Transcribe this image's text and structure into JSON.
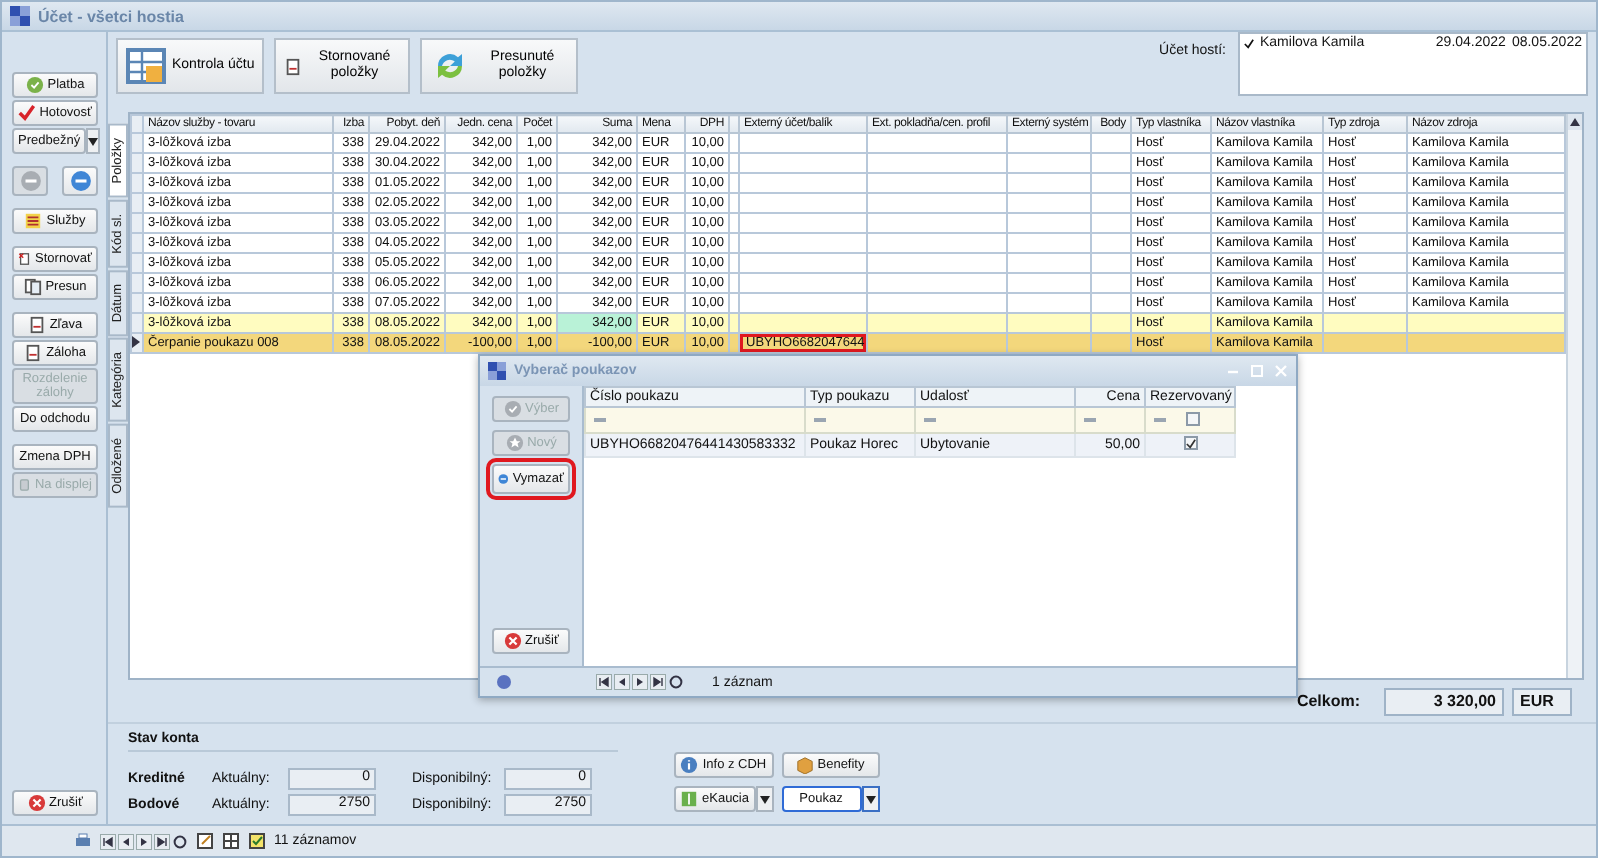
{
  "window": {
    "title": "Účet - všetci hostia"
  },
  "sidebar": {
    "groups": [
      [
        {
          "kind": "button",
          "label": "Platba",
          "disabled": false
        },
        {
          "kind": "button",
          "label": "Hotovosť",
          "disabled": false
        },
        {
          "kind": "dropdown",
          "label": "Predbežný",
          "disabled": false
        }
      ],
      [
        {
          "kind": "icons",
          "buttons": [
            {
              "disabled": true
            },
            {
              "disabled": false
            }
          ]
        }
      ],
      [
        {
          "kind": "button",
          "label": "Služby",
          "disabled": false
        }
      ],
      [
        {
          "kind": "button",
          "label": "Stornovať",
          "disabled": false
        },
        {
          "kind": "button",
          "label": "Presun",
          "disabled": false
        }
      ],
      [
        {
          "kind": "button",
          "label": "Zľava",
          "disabled": false
        },
        {
          "kind": "button",
          "label": "Záloha",
          "disabled": false
        },
        {
          "kind": "button",
          "label": "Rozdelenie zálohy",
          "disabled": true
        },
        {
          "kind": "button",
          "label": "Do odchodu",
          "disabled": false
        }
      ],
      [
        {
          "kind": "button",
          "label": "Zmena DPH",
          "disabled": false
        },
        {
          "kind": "button",
          "label": "Na displej",
          "disabled": true
        }
      ]
    ],
    "cancel": {
      "label": "Zrušiť"
    }
  },
  "toolbar": [
    {
      "label": "Kontrola účtu"
    },
    {
      "label": "Stornované položky"
    },
    {
      "label": "Presunuté položky"
    }
  ],
  "guest_accounts": {
    "label": "Účet hostí:",
    "items": [
      {
        "checked": true,
        "name": "Kamilova Kamila",
        "from": "29.04.2022",
        "to": "08.05.2022"
      }
    ]
  },
  "tabs": [
    {
      "label": "Položky",
      "selected": true
    },
    {
      "label": "Kód sl.",
      "selected": false
    },
    {
      "label": "Dátum",
      "selected": false
    },
    {
      "label": "Kategória",
      "selected": false
    },
    {
      "label": "Odložené",
      "selected": false
    }
  ],
  "table": {
    "columns": [
      {
        "label": "Názov služby - tovaru"
      },
      {
        "label": "Izba"
      },
      {
        "label": "Pobyt. deň"
      },
      {
        "label": "Jedn. cena"
      },
      {
        "label": "Počet"
      },
      {
        "label": "Suma"
      },
      {
        "label": "Mena"
      },
      {
        "label": "DPH"
      },
      {},
      {
        "label": "Externý účet/balík"
      },
      {
        "label": "Ext. pokladňa/cen. profil"
      },
      {
        "label": "Externý systém"
      },
      {
        "label": "Body"
      },
      {
        "label": "Typ vlastníka"
      },
      {
        "label": "Názov vlastníka"
      },
      {
        "label": "Typ zdroja"
      },
      {
        "label": "Názov zdroja"
      }
    ],
    "rows": [
      {
        "selected": false,
        "marked": false,
        "cells": [
          "3-lôžková izba",
          "338",
          "29.04.2022",
          "342,00",
          "1,00",
          "342,00",
          "EUR",
          "10,00",
          null,
          null,
          null,
          null,
          null,
          "Hosť",
          "Kamilova Kamila",
          "Hosť",
          "Kamilova Kamila"
        ]
      },
      {
        "selected": false,
        "marked": false,
        "cells": [
          "3-lôžková izba",
          "338",
          "30.04.2022",
          "342,00",
          "1,00",
          "342,00",
          "EUR",
          "10,00",
          null,
          null,
          null,
          null,
          null,
          "Hosť",
          "Kamilova Kamila",
          "Hosť",
          "Kamilova Kamila"
        ]
      },
      {
        "selected": false,
        "marked": false,
        "cells": [
          "3-lôžková izba",
          "338",
          "01.05.2022",
          "342,00",
          "1,00",
          "342,00",
          "EUR",
          "10,00",
          null,
          null,
          null,
          null,
          null,
          "Hosť",
          "Kamilova Kamila",
          "Hosť",
          "Kamilova Kamila"
        ]
      },
      {
        "selected": false,
        "marked": false,
        "cells": [
          "3-lôžková izba",
          "338",
          "02.05.2022",
          "342,00",
          "1,00",
          "342,00",
          "EUR",
          "10,00",
          null,
          null,
          null,
          null,
          null,
          "Hosť",
          "Kamilova Kamila",
          "Hosť",
          "Kamilova Kamila"
        ]
      },
      {
        "selected": false,
        "marked": false,
        "cells": [
          "3-lôžková izba",
          "338",
          "03.05.2022",
          "342,00",
          "1,00",
          "342,00",
          "EUR",
          "10,00",
          null,
          null,
          null,
          null,
          null,
          "Hosť",
          "Kamilova Kamila",
          "Hosť",
          "Kamilova Kamila"
        ]
      },
      {
        "selected": false,
        "marked": false,
        "cells": [
          "3-lôžková izba",
          "338",
          "04.05.2022",
          "342,00",
          "1,00",
          "342,00",
          "EUR",
          "10,00",
          null,
          null,
          null,
          null,
          null,
          "Hosť",
          "Kamilova Kamila",
          "Hosť",
          "Kamilova Kamila"
        ]
      },
      {
        "selected": false,
        "marked": false,
        "cells": [
          "3-lôžková izba",
          "338",
          "05.05.2022",
          "342,00",
          "1,00",
          "342,00",
          "EUR",
          "10,00",
          null,
          null,
          null,
          null,
          null,
          "Hosť",
          "Kamilova Kamila",
          "Hosť",
          "Kamilova Kamila"
        ]
      },
      {
        "selected": false,
        "marked": false,
        "cells": [
          "3-lôžková izba",
          "338",
          "06.05.2022",
          "342,00",
          "1,00",
          "342,00",
          "EUR",
          "10,00",
          null,
          null,
          null,
          null,
          null,
          "Hosť",
          "Kamilova Kamila",
          "Hosť",
          "Kamilova Kamila"
        ]
      },
      {
        "selected": false,
        "marked": false,
        "cells": [
          "3-lôžková izba",
          "338",
          "07.05.2022",
          "342,00",
          "1,00",
          "342,00",
          "EUR",
          "10,00",
          null,
          null,
          null,
          null,
          null,
          "Hosť",
          "Kamilova Kamila",
          "Hosť",
          "Kamilova Kamila"
        ]
      },
      {
        "selected": false,
        "marked": true,
        "cells": [
          "3-lôžková izba",
          "338",
          "08.05.2022",
          "342,00",
          "1,00",
          {
            "text": "342,00",
            "focused": true
          },
          "EUR",
          "10,00",
          null,
          null,
          null,
          null,
          null,
          "Hosť",
          "Kamilova Kamila",
          null,
          null
        ]
      },
      {
        "selected": true,
        "marked": false,
        "cells": [
          "Čerpanie poukazu 008",
          "338",
          "08.05.2022",
          "-100,00",
          "1,00",
          "-100,00",
          "EUR",
          "10,00",
          null,
          {
            "text": "UBYHO6682047644",
            "boxed": true
          },
          null,
          null,
          null,
          "Hosť",
          "Kamilova Kamila",
          null,
          null
        ]
      }
    ]
  },
  "dialog": {
    "title": "Vyberač poukazov",
    "buttons": [
      {
        "label": "Výber",
        "disabled": true,
        "boxed": false
      },
      {
        "label": "Nový",
        "disabled": true,
        "boxed": false
      },
      {
        "label": "Vymazať",
        "disabled": false,
        "boxed": true
      }
    ],
    "cancel": {
      "label": "Zrušiť"
    },
    "columns": [
      {
        "label": "Číslo poukazu",
        "kind": "text"
      },
      {
        "label": "Typ poukazu",
        "kind": "text"
      },
      {
        "label": "Udalosť",
        "kind": "text"
      },
      {
        "label": "Cena",
        "kind": "number"
      },
      {
        "label": "Rezervovaný",
        "kind": "bool",
        "filter_checked": false
      }
    ],
    "rows": [
      {
        "cells": [
          "UBYHO66820476441430583332",
          "Poukaz Horec",
          "Ubytovanie",
          "50,00",
          true
        ]
      }
    ],
    "status": "1 záznam"
  },
  "totals": {
    "label": "Celkom:",
    "value": "3 320,00",
    "currency": "EUR"
  },
  "account": {
    "title": "Stav konta",
    "rows": [
      {
        "label": "Kreditné",
        "current_label": "Aktuálny:",
        "current": "0",
        "available_label": "Disponibilný:",
        "available": "0"
      },
      {
        "label": "Bodové",
        "current_label": "Aktuálny:",
        "current": "2750",
        "available_label": "Disponibilný:",
        "available": "2750"
      }
    ]
  },
  "actions": [
    {
      "kind": "button",
      "label": "Info z CDH",
      "focused": false
    },
    {
      "kind": "button",
      "label": "Benefity",
      "focused": false
    },
    {
      "kind": "split",
      "label": "eKaucia",
      "focused": false
    },
    {
      "kind": "split",
      "label": "Poukaz",
      "focused": true
    }
  ],
  "status_bar": {
    "text": "11 záznamov"
  }
}
